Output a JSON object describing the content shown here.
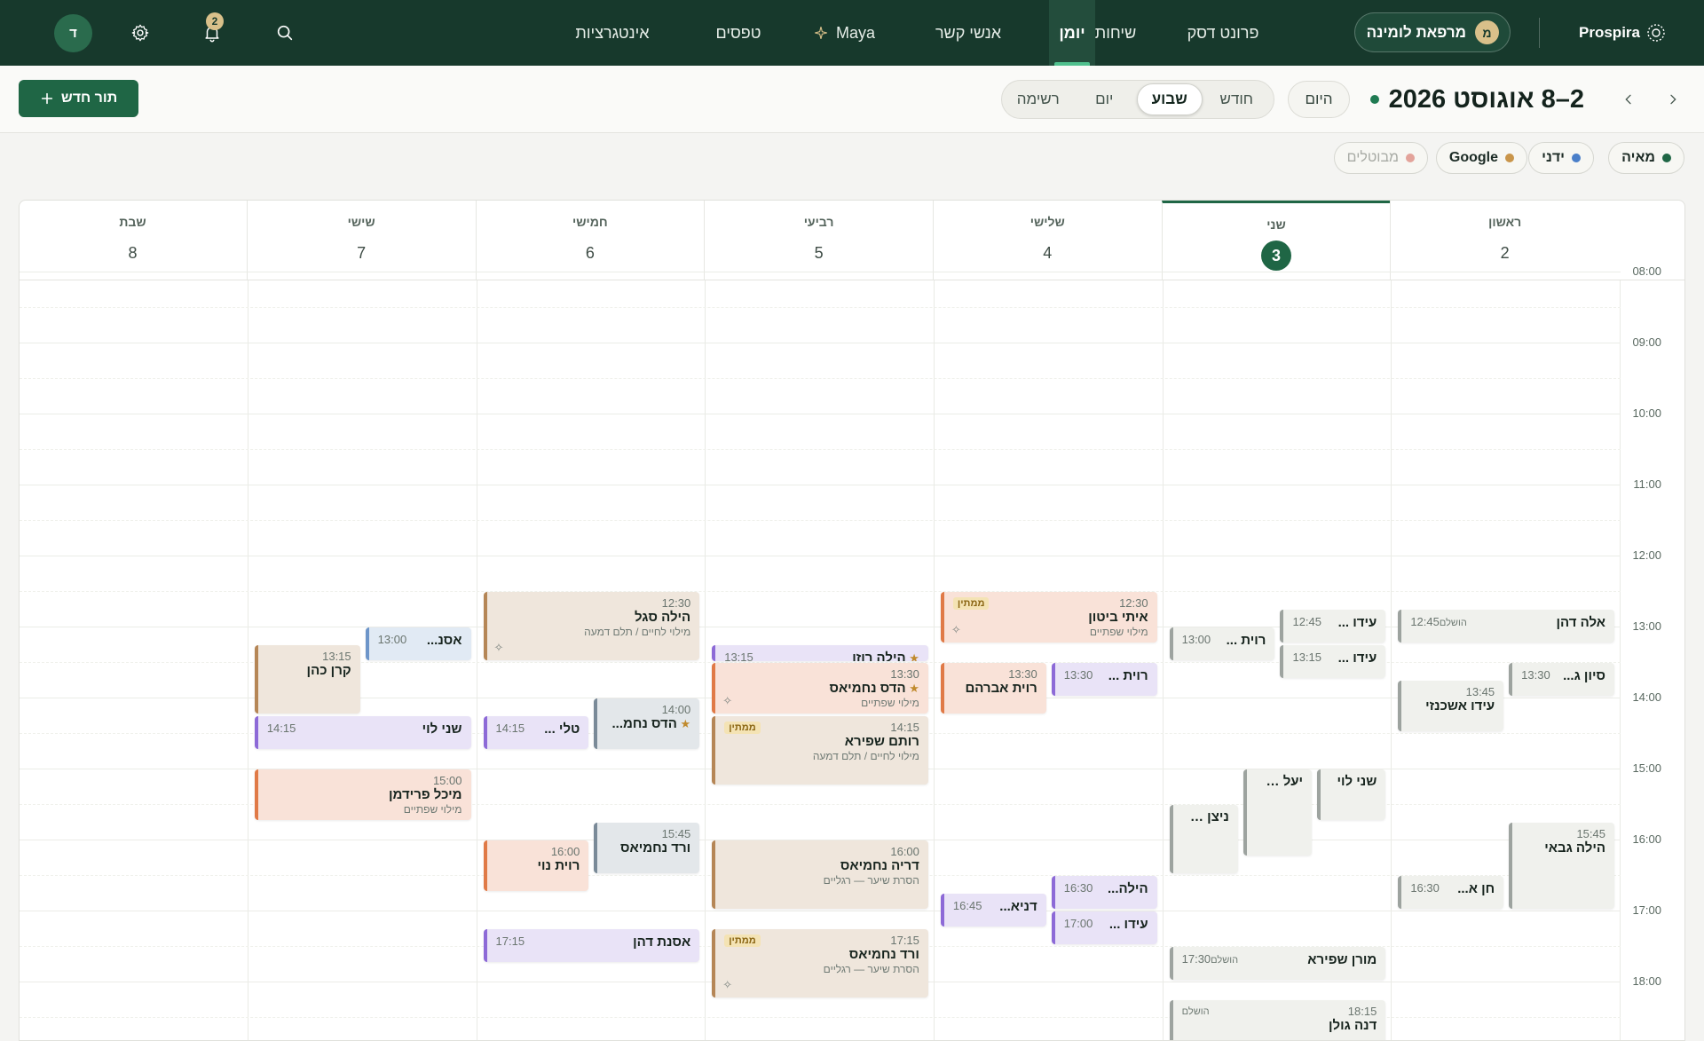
{
  "app": {
    "logo_text": "Prospira",
    "clinic_name": "מרפאת לומינה",
    "clinic_initial": "מ",
    "user_initial": "ד",
    "notifications_count": "2"
  },
  "nav": [
    {
      "label": "פרונט דסק",
      "active": false
    },
    {
      "label": "שיחות",
      "active": false
    },
    {
      "label": "יומן",
      "active": true
    },
    {
      "label": "אנשי קשר",
      "active": false
    },
    {
      "label": "Maya",
      "active": false
    },
    {
      "label": "טפסים",
      "active": false
    },
    {
      "label": "אינטגרציות",
      "active": false
    }
  ],
  "toolbar": {
    "range_title": "2–8 אוגוסט 2026",
    "today_label": "היום",
    "views": [
      {
        "label": "חודש",
        "active": false
      },
      {
        "label": "שבוע",
        "active": true
      },
      {
        "label": "יום",
        "active": false
      },
      {
        "label": "רשימה",
        "active": false
      }
    ],
    "new_appointment_label": "תור חדש"
  },
  "filters": [
    {
      "label": "מאיה",
      "color": "#1f6645"
    },
    {
      "label": "ידני",
      "color": "#4a7fc9"
    },
    {
      "label": "Google",
      "color": "#c9954a"
    },
    {
      "label": "מבוטלים",
      "color": "#e3a39a",
      "muted": true
    }
  ],
  "days": [
    {
      "name": "ראשון",
      "num": "2"
    },
    {
      "name": "שני",
      "num": "3",
      "today": true
    },
    {
      "name": "שלישי",
      "num": "4"
    },
    {
      "name": "רביעי",
      "num": "5"
    },
    {
      "name": "חמישי",
      "num": "6"
    },
    {
      "name": "שישי",
      "num": "7"
    },
    {
      "name": "שבת",
      "num": "8"
    }
  ],
  "hours": [
    "08:00",
    "09:00",
    "10:00",
    "11:00",
    "12:00",
    "13:00",
    "14:00",
    "15:00",
    "16:00",
    "17:00",
    "18:00"
  ],
  "labels": {
    "completed": "הושלם",
    "pending": "ממתין"
  },
  "events": [
    {
      "day": 0,
      "start": "12:45",
      "end": "13:15",
      "lane": 0,
      "lanes": 1,
      "name": "אלה דהן",
      "time": "12:45",
      "color": "gray",
      "tag": "completed"
    },
    {
      "day": 0,
      "start": "13:30",
      "end": "14:00",
      "lane": 0,
      "lanes": 2,
      "name": "סיון ג...",
      "time": "13:30",
      "color": "gray"
    },
    {
      "day": 0,
      "start": "13:45",
      "end": "14:30",
      "lane": 1,
      "lanes": 2,
      "name": "עידו אשכנזי",
      "time": "13:45",
      "color": "gray",
      "layout": "stack"
    },
    {
      "day": 0,
      "start": "15:45",
      "end": "17:00",
      "lane": 0,
      "lanes": 2,
      "name": "הילה גבאי",
      "time": "15:45",
      "color": "gray",
      "layout": "stack"
    },
    {
      "day": 0,
      "start": "16:30",
      "end": "17:00",
      "lane": 1,
      "lanes": 2,
      "name": "חן א...",
      "time": "16:30",
      "color": "gray"
    },
    {
      "day": 1,
      "start": "12:45",
      "end": "13:15",
      "lane": 0,
      "lanes": 2,
      "name": "עידו ...",
      "time": "12:45",
      "color": "gray"
    },
    {
      "day": 1,
      "start": "13:00",
      "end": "13:30",
      "lane": 1,
      "lanes": 2,
      "name": "רוית ...",
      "time": "13:00",
      "color": "gray"
    },
    {
      "day": 1,
      "start": "13:15",
      "end": "13:45",
      "lane": 0,
      "lanes": 2,
      "name": "עידו ...",
      "time": "13:15",
      "color": "gray"
    },
    {
      "day": 1,
      "start": "15:00",
      "end": "15:45",
      "lane": 0,
      "lanes": 3,
      "name": "שני לוי",
      "time": "",
      "color": "gray"
    },
    {
      "day": 1,
      "start": "15:00",
      "end": "16:15",
      "lane": 1,
      "lanes": 3,
      "name": "יעל ח...",
      "time": "",
      "color": "gray"
    },
    {
      "day": 1,
      "start": "15:30",
      "end": "16:30",
      "lane": 2,
      "lanes": 3,
      "name": "ניצן גו...",
      "time": "",
      "color": "gray"
    },
    {
      "day": 1,
      "start": "17:30",
      "end": "18:00",
      "lane": 0,
      "lanes": 1,
      "name": "מורן שפירא",
      "time": "17:30",
      "color": "gray",
      "tag": "completed"
    },
    {
      "day": 1,
      "start": "18:15",
      "end": "19:00",
      "lane": 0,
      "lanes": 1,
      "name": "דנה גולן",
      "time": "18:15",
      "color": "gray",
      "tag": "completed",
      "layout": "stack"
    },
    {
      "day": 2,
      "start": "12:30",
      "end": "13:15",
      "lane": 0,
      "lanes": 1,
      "name": "איתי ביטון",
      "time": "12:30",
      "sub": "מילוי שפתיים",
      "color": "peach",
      "tag": "pending",
      "spark": true,
      "layout": "stack"
    },
    {
      "day": 2,
      "start": "13:30",
      "end": "14:00",
      "lane": 0,
      "lanes": 2,
      "name": "רוית ...",
      "time": "13:30",
      "color": "lav"
    },
    {
      "day": 2,
      "start": "13:30",
      "end": "14:15",
      "lane": 1,
      "lanes": 2,
      "name": "רוית אברהם",
      "time": "13:30",
      "color": "peach",
      "layout": "stack"
    },
    {
      "day": 2,
      "start": "16:30",
      "end": "17:00",
      "lane": 0,
      "lanes": 2,
      "name": "הילה...",
      "time": "16:30",
      "color": "lav"
    },
    {
      "day": 2,
      "start": "16:45",
      "end": "17:15",
      "lane": 1,
      "lanes": 2,
      "name": "דניא...",
      "time": "16:45",
      "color": "lav"
    },
    {
      "day": 2,
      "start": "17:00",
      "end": "17:30",
      "lane": 0,
      "lanes": 2,
      "name": "עידו ...",
      "time": "17:00",
      "color": "lav"
    },
    {
      "day": 3,
      "start": "13:15",
      "end": "13:30",
      "lane": 0,
      "lanes": 1,
      "name": "הילה רוזו",
      "time": "13:15",
      "color": "lav",
      "star": true
    },
    {
      "day": 3,
      "start": "13:30",
      "end": "14:15",
      "lane": 0,
      "lanes": 1,
      "name": "הדס נחמיאס",
      "time": "13:30",
      "sub": "מילוי שפתיים",
      "color": "peach",
      "star": true,
      "spark": true,
      "layout": "stack"
    },
    {
      "day": 3,
      "start": "14:15",
      "end": "15:15",
      "lane": 0,
      "lanes": 1,
      "name": "רותם שפירא",
      "time": "14:15",
      "sub": "מילוי לחיים / תלם דמעה",
      "color": "sand",
      "tag": "pending",
      "layout": "stack"
    },
    {
      "day": 3,
      "start": "16:00",
      "end": "17:00",
      "lane": 0,
      "lanes": 1,
      "name": "דריה נחמיאס",
      "time": "16:00",
      "sub": "הסרת שיער — רגליים",
      "color": "sand",
      "layout": "stack"
    },
    {
      "day": 3,
      "start": "17:15",
      "end": "18:15",
      "lane": 0,
      "lanes": 1,
      "name": "ורד נחמיאס",
      "time": "17:15",
      "sub": "הסרת שיער — רגליים",
      "color": "sand",
      "tag": "pending",
      "spark": true,
      "layout": "stack"
    },
    {
      "day": 4,
      "start": "12:30",
      "end": "13:30",
      "lane": 0,
      "lanes": 1,
      "name": "הילה סגל",
      "time": "12:30",
      "sub": "מילוי לחיים / תלם דמעה",
      "color": "sand",
      "spark": true,
      "layout": "stack"
    },
    {
      "day": 4,
      "start": "14:00",
      "end": "14:45",
      "lane": 0,
      "lanes": 2,
      "name": "הדס נחמ...",
      "time": "14:00",
      "color": "slate",
      "star": true,
      "layout": "stack"
    },
    {
      "day": 4,
      "start": "14:15",
      "end": "14:45",
      "lane": 1,
      "lanes": 2,
      "name": "טלי ...",
      "time": "14:15",
      "color": "lav"
    },
    {
      "day": 4,
      "start": "15:45",
      "end": "16:30",
      "lane": 0,
      "lanes": 2,
      "name": "ורד נחמיאס",
      "time": "15:45",
      "color": "slate",
      "layout": "stack"
    },
    {
      "day": 4,
      "start": "16:00",
      "end": "16:45",
      "lane": 1,
      "lanes": 2,
      "name": "רוית נוי",
      "time": "16:00",
      "color": "peach",
      "layout": "stack"
    },
    {
      "day": 4,
      "start": "17:15",
      "end": "17:45",
      "lane": 0,
      "lanes": 1,
      "name": "אסנת דהן",
      "time": "17:15",
      "color": "lav"
    },
    {
      "day": 5,
      "start": "13:00",
      "end": "13:30",
      "lane": 0,
      "lanes": 2,
      "name": "אסנ...",
      "time": "13:00",
      "color": "blue"
    },
    {
      "day": 5,
      "start": "13:15",
      "end": "14:15",
      "lane": 1,
      "lanes": 2,
      "name": "קרן כהן",
      "time": "13:15",
      "color": "sand",
      "layout": "stack"
    },
    {
      "day": 5,
      "start": "14:15",
      "end": "14:45",
      "lane": 0,
      "lanes": 1,
      "name": "שני לוי",
      "time": "14:15",
      "color": "lav"
    },
    {
      "day": 5,
      "start": "15:00",
      "end": "15:45",
      "lane": 0,
      "lanes": 1,
      "name": "מיכל פרידמן",
      "time": "15:00",
      "sub": "מילוי שפתיים",
      "color": "peach",
      "layout": "stack"
    }
  ]
}
